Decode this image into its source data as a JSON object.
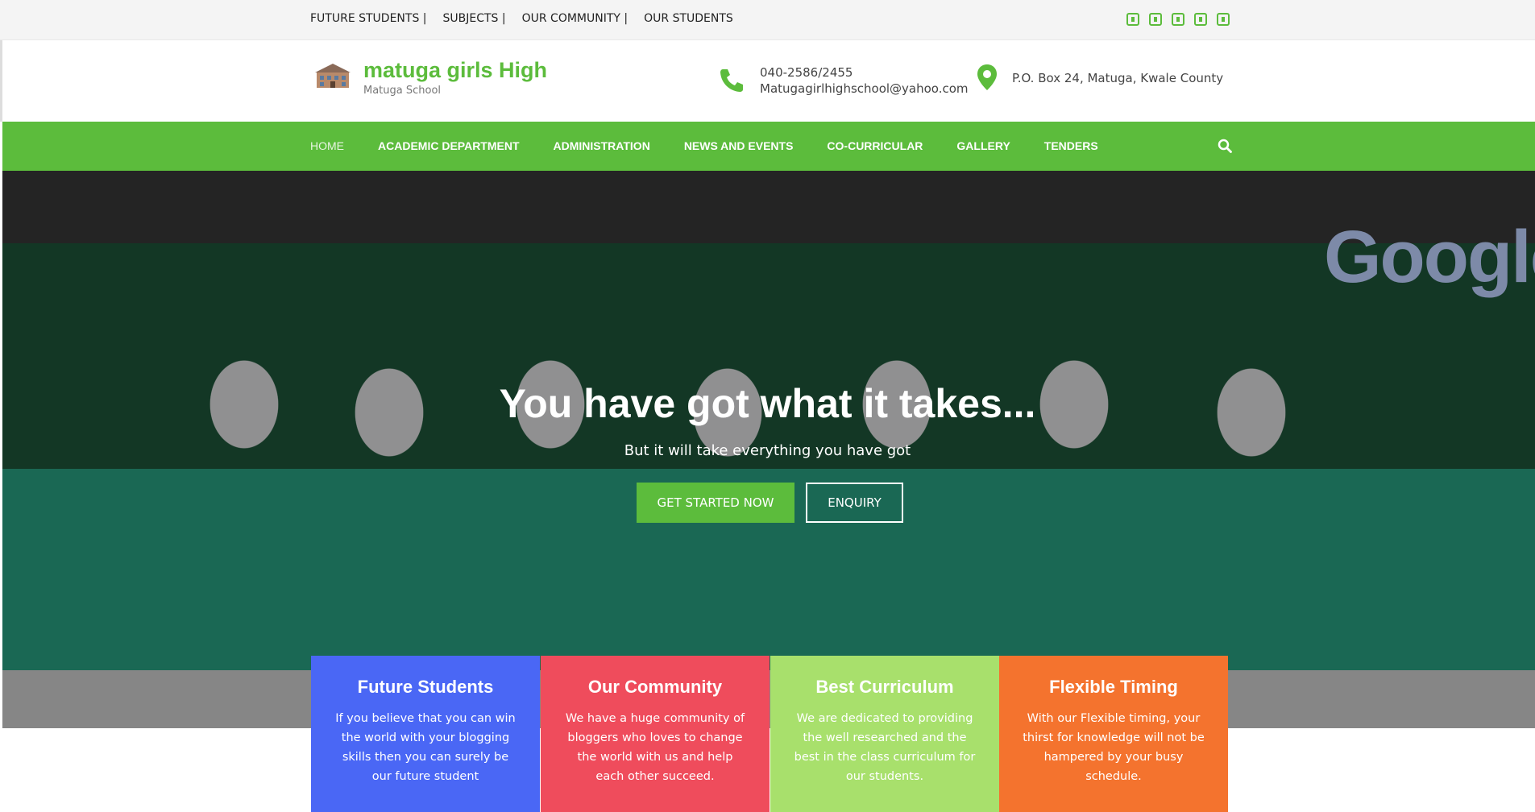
{
  "topbar": {
    "links": [
      "FUTURE STUDENTS |",
      "SUBJECTS |",
      "OUR COMMUNITY |",
      "OUR STUDENTS"
    ],
    "socials": [
      "facebook-icon",
      "twitter-icon",
      "linkedin-icon",
      "instagram-icon",
      "youtube-icon"
    ]
  },
  "header": {
    "title": "matuga girls High",
    "subtitle": "Matuga School",
    "phone": "040-2586/2455",
    "email": "Matugagirlhighschool@yahoo.com",
    "address": "P.O. Box 24, Matuga, Kwale County"
  },
  "nav": {
    "items": [
      "HOME",
      "ACADEMIC DEPARTMENT",
      "ADMINISTRATION",
      "NEWS AND EVENTS",
      "CO-CURRICULAR",
      "GALLERY",
      "TENDERS"
    ]
  },
  "hero": {
    "background_text": "Google",
    "title": "You have got what it takes...",
    "subtitle": "But it will take everything you have got",
    "primary_button": "GET STARTED NOW",
    "secondary_button": "ENQUIRY"
  },
  "cards": [
    {
      "title": "Future Students",
      "text": "If you believe that you can win the world with your blogging skills then you can surely be our future student"
    },
    {
      "title": "Our Community",
      "text": "We have a huge community of bloggers who loves to change the world with us and help each other succeed."
    },
    {
      "title": "Best Curriculum",
      "text": "We are dedicated to providing the well researched and the best in the class curriculum for our students."
    },
    {
      "title": "Flexible Timing",
      "text": "With our Flexible timing, your thirst for knowledge will not be hampered by your busy schedule."
    }
  ],
  "colors": {
    "accent": "#5cbc3c",
    "card_blue": "#4a67f5",
    "card_red": "#ef4c5c",
    "card_green": "#a8e06c",
    "card_orange": "#f4732e"
  }
}
